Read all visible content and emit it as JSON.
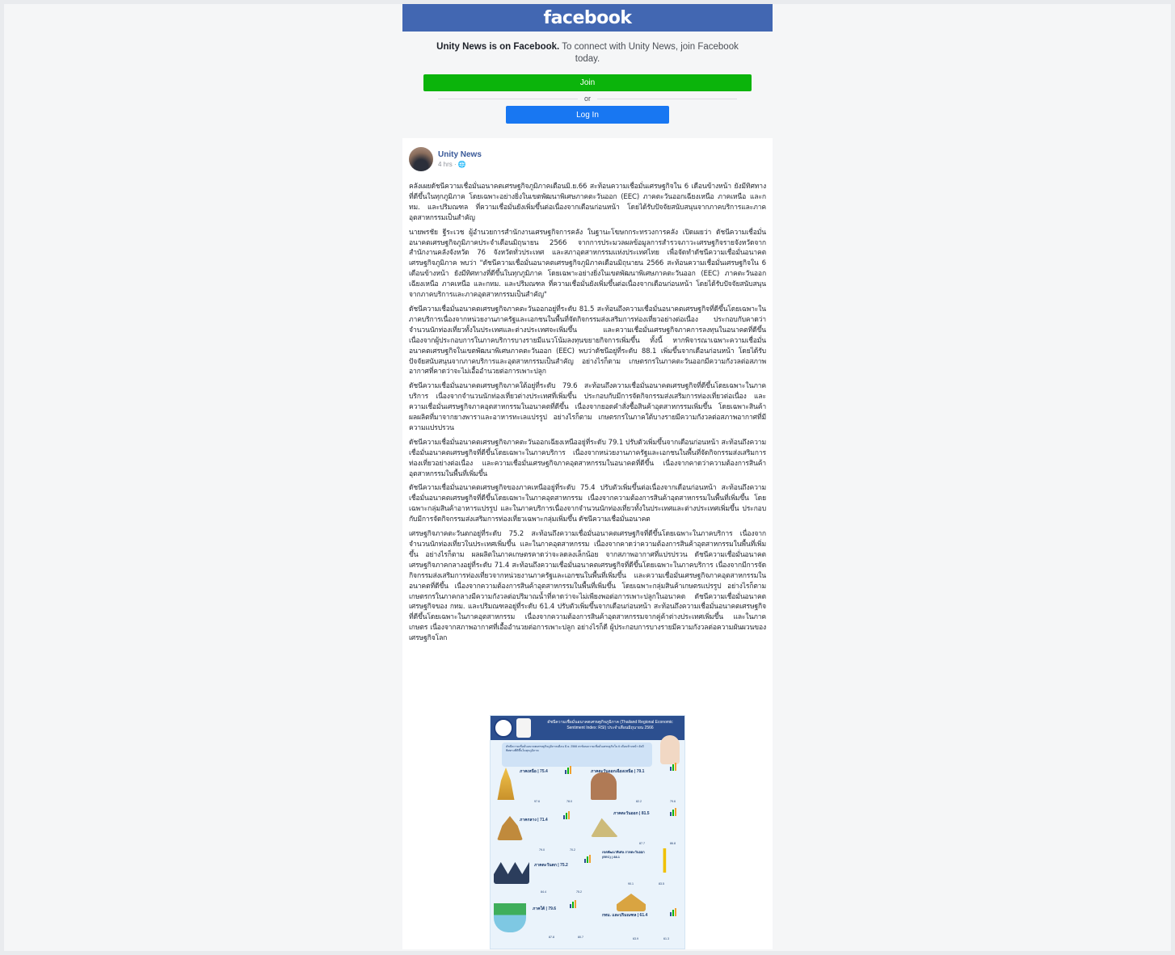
{
  "header": {
    "logo": "facebook"
  },
  "join_panel": {
    "page_name": "Unity News is on Facebook.",
    "message": "To connect with Unity News, join Facebook today.",
    "join_label": "Join",
    "or_label": "or",
    "login_label": "Log In"
  },
  "post": {
    "author": "Unity News",
    "meta": "4 hrs · ",
    "paragraphs": [
      "คลังเผยดัชนีความเชื่อมั่นอนาคตเศรษฐกิจภูมิภาคเดือนมิ.ย.66 สะท้อนความเชื่อมั่นเศรษฐกิจใน 6 เดือนข้างหน้า ยังมีทิศทางที่ดีขึ้นในทุกภูมิภาค โดยเฉพาะอย่างยิ่งในเขตพัฒนาพิเศษภาคตะวันออก (EEC) ภาคตะวันออกเฉียงเหนือ ภาคเหนือ และกทม. และปริมณฑล ที่ความเชื่อมั่นยังเพิ่มขึ้นต่อเนื่องจากเดือนก่อนหน้า โดยได้รับปัจจัยสนับสนุนจากภาคบริการและภาคอุตสาหกรรมเป็นสำคัญ",
      "นายพรชัย ฐีระเวช ผู้อำนวยการสำนักงานเศรษฐกิจการคลัง ในฐานะโฆษกกระทรวงการคลัง เปิดเผยว่า ดัชนีความเชื่อมั่นอนาคตเศรษฐกิจภูมิภาคประจำเดือนมิถุนายน 2566 จากการประมวลผลข้อมูลการสำรวจภาวะเศรษฐกิจรายจังหวัดจากสำนักงานคลังจังหวัด 76 จังหวัดทั่วประเทศ และสภาอุตสาหกรรมแห่งประเทศไทย เพื่อจัดทำดัชนีความเชื่อมั่นอนาคตเศรษฐกิจภูมิภาค พบว่า \"ดัชนีความเชื่อมั่นอนาคตเศรษฐกิจภูมิภาคเดือนมิถุนายน 2566 สะท้อนความเชื่อมั่นเศรษฐกิจใน 6 เดือนข้างหน้า ยังมีทิศทางที่ดีขึ้นในทุกภูมิภาค โดยเฉพาะอย่างยิ่งในเขตพัฒนาพิเศษภาคตะวันออก (EEC) ภาคตะวันออกเฉียงเหนือ ภาคเหนือ และกทม. และปริมณฑล ที่ความเชื่อมั่นยังเพิ่มขึ้นต่อเนื่องจากเดือนก่อนหน้า โดยได้รับปัจจัยสนับสนุนจากภาคบริการและภาคอุตสาหกรรมเป็นสำคัญ\"",
      "ดัชนีความเชื่อมั่นอนาคตเศรษฐกิจภาคตะวันออกอยู่ที่ระดับ 81.5 สะท้อนถึงความเชื่อมั่นอนาคตเศรษฐกิจที่ดีขึ้นโดยเฉพาะในภาคบริการเนื่องจากหน่วยงานภาครัฐและเอกชนในพื้นที่จัดกิจกรรมส่งเสริมการท่องเที่ยวอย่างต่อเนื่อง ประกอบกับคาดว่าจำนวนนักท่องเที่ยวทั้งในประเทศและต่างประเทศจะเพิ่มขึ้น และความเชื่อมั่นเศรษฐกิจภาคการลงทุนในอนาคตที่ดีขึ้น เนื่องจากผู้ประกอบการในภาคบริการบางรายมีแนวโน้มลงทุนขยายกิจการเพิ่มขึ้น ทั้งนี้ หากพิจารณาเฉพาะความเชื่อมั่นอนาคตเศรษฐกิจในเขตพัฒนาพิเศษภาคตะวันออก (EEC) พบว่าดัชนีอยู่ที่ระดับ 88.1 เพิ่มขึ้นจากเดือนก่อนหน้า โดยได้รับปัจจัยสนับสนุนจากภาคบริการและอุตสาหกรรมเป็นสำคัญ อย่างไรก็ตาม เกษตรกรในภาคตะวันออกมีความกังวลต่อสภาพอากาศที่คาดว่าจะไม่เอื้ออำนวยต่อการเพาะปลูก",
      "ดัชนีความเชื่อมั่นอนาคตเศรษฐกิจภาคใต้อยู่ที่ระดับ 79.6 สะท้อนถึงความเชื่อมั่นอนาคตเศรษฐกิจที่ดีขึ้นโดยเฉพาะในภาคบริการ เนื่องจากจำนวนนักท่องเที่ยวต่างประเทศที่เพิ่มขึ้น ประกอบกับมีการจัดกิจกรรมส่งเสริมการท่องเที่ยวต่อเนื่อง และความเชื่อมั่นเศรษฐกิจภาคอุตสาหกรรมในอนาคตที่ดีขึ้น เนื่องจากยอดคำสั่งซื้อสินค้าอุตสาหกรรมเพิ่มขึ้น โดยเฉพาะสินค้าผลผลิตที่มาจากยางพาราและอาหารทะเลแปรรูป อย่างไรก็ตาม เกษตรกรในภาคใต้บางรายมีความกังวลต่อสภาพอากาศที่มีความแปรปรวน",
      "ดัชนีความเชื่อมั่นอนาคตเศรษฐกิจภาคตะวันออกเฉียงเหนืออยู่ที่ระดับ 79.1 ปรับตัวเพิ่มขึ้นจากเดือนก่อนหน้า สะท้อนถึงความเชื่อมั่นอนาคตเศรษฐกิจที่ดีขึ้นโดยเฉพาะในภาคบริการ เนื่องจากหน่วยงานภาครัฐและเอกชนในพื้นที่จัดกิจกรรมส่งเสริมการท่องเที่ยวอย่างต่อเนื่อง และความเชื่อมั่นเศรษฐกิจภาคอุตสาหกรรมในอนาคตที่ดีขึ้น เนื่องจากคาดว่าความต้องการสินค้าอุตสาหกรรมในพื้นที่เพิ่มขึ้น",
      "ดัชนีความเชื่อมั่นอนาคตเศรษฐกิจของภาคเหนืออยู่ที่ระดับ 75.4 ปรับตัวเพิ่มขึ้นต่อเนื่องจากเดือนก่อนหน้า สะท้อนถึงความเชื่อมั่นอนาคตเศรษฐกิจที่ดีขึ้นโดยเฉพาะในภาคอุตสาหกรรม เนื่องจากความต้องการสินค้าอุตสาหกรรมในพื้นที่เพิ่มขึ้น โดยเฉพาะกลุ่มสินค้าอาหารแปรรูป และในภาคบริการเนื่องจากจำนวนนักท่องเที่ยวทั้งในประเทศและต่างประเทศเพิ่มขึ้น ประกอบกับมีการจัดกิจกรรมส่งเสริมการท่องเที่ยวเฉพาะกลุ่มเพิ่มขึ้น ดัชนีความเชื่อมั่นอนาคต",
      "เศรษฐกิจภาคตะวันตกอยู่ที่ระดับ 75.2 สะท้อนถึงความเชื่อมั่นอนาคตเศรษฐกิจที่ดีขึ้นโดยเฉพาะในภาคบริการ เนื่องจากจำนวนนักท่องเที่ยวในประเทศเพิ่มขึ้น และในภาคอุตสาหกรรม เนื่องจากคาดว่าความต้องการสินค้าอุตสาหกรรมในพื้นที่เพิ่มขึ้น อย่างไรก็ตาม ผลผลิตในภาคเกษตรคาดว่าจะลดลงเล็กน้อย จากสภาพอากาศที่แปรปรวน ดัชนีความเชื่อมั่นอนาคตเศรษฐกิจภาคกลางอยู่ที่ระดับ 71.4 สะท้อนถึงความเชื่อมั่นอนาคตเศรษฐกิจที่ดีขึ้นโดยเฉพาะในภาคบริการ เนื่องจากมีการจัดกิจกรรมส่งเสริมการท่องเที่ยวจากหน่วยงานภาครัฐและเอกชนในพื้นที่เพิ่มขึ้น และความเชื่อมั่นเศรษฐกิจภาคอุตสาหกรรมในอนาคตที่ดีขึ้น เนื่องจากความต้องการสินค้าอุตสาหกรรมในพื้นที่เพิ่มขึ้น โดยเฉพาะกลุ่มสินค้าเกษตรแปรรูป อย่างไรก็ตาม เกษตรกรในภาคกลางมีความกังวลต่อปริมาณน้ำที่คาดว่าจะไม่เพียงพอต่อการเพาะปลูกในอนาคต ดัชนีความเชื่อมั่นอนาคตเศรษฐกิจของ กทม. และปริมณฑลอยู่ที่ระดับ 61.4 ปรับตัวเพิ่มขึ้นจากเดือนก่อนหน้า สะท้อนถึงความเชื่อมั่นอนาคตเศรษฐกิจที่ดีขึ้นโดยเฉพาะในภาคอุตสาหกรรม เนื่องจากความต้องการสินค้าอุตสาหกรรมจากคู่ค้าต่างประเทศเพิ่มขึ้น และในภาคเกษตร เนื่องจากสภาพอากาศที่เอื้ออำนวยต่อการเพาะปลูก อย่างไรก็ดี ผู้ประกอบการบางรายมีความกังวลต่อความผันผวนของเศรษฐกิจโลก"
    ]
  },
  "infographic": {
    "title": "ดัชนีความเชื่อมั่นอนาคตเศรษฐกิจภูมิภาค (Thailand Regional Economic Sentiment Index: RSI) ประจำเดือนมิถุนายน 2566",
    "intro": "ดัชนีความเชื่อมั่นอนาคตเศรษฐกิจภูมิภาคเดือน มิ.ย. 2566 สะท้อนความเชื่อมั่นเศรษฐกิจใน 6 เดือนข้างหน้า ยังมีทิศทางที่ดีขึ้นในทุกภูมิภาค",
    "regions": [
      {
        "name": "ภาคเหนือ | 75.4",
        "a": "97.6",
        "b": "78.0"
      },
      {
        "name": "ภาคตะวันออกเฉียงเหนือ | 79.1",
        "a": "82.2",
        "b": "79.6"
      },
      {
        "name": "ภาคกลาง | 71.4",
        "a": "79.0",
        "b": "70.2"
      },
      {
        "name": "ภาคตะวันออก | 81.5",
        "a": "87.7",
        "b": "86.8"
      },
      {
        "name": "ภาคตะวันตก | 75.2",
        "a": "84.4",
        "b": "75.2"
      },
      {
        "name": "เขตพัฒนาพิเศษ ภาคตะวันออก (EEC) | 88.1",
        "a": "90.1",
        "b": "83.5"
      },
      {
        "name": "ภาคใต้ | 79.6",
        "a": "87.8",
        "b": "80.7"
      },
      {
        "name": "กทม. และปริมณฑล | 61.4",
        "a": "63.9",
        "b": "61.3"
      }
    ],
    "colors": {
      "header": "#2c4f8f",
      "background": "#eaf3fb",
      "accent_green": "#0bb40b",
      "facebook_blue": "#4267b2"
    }
  }
}
